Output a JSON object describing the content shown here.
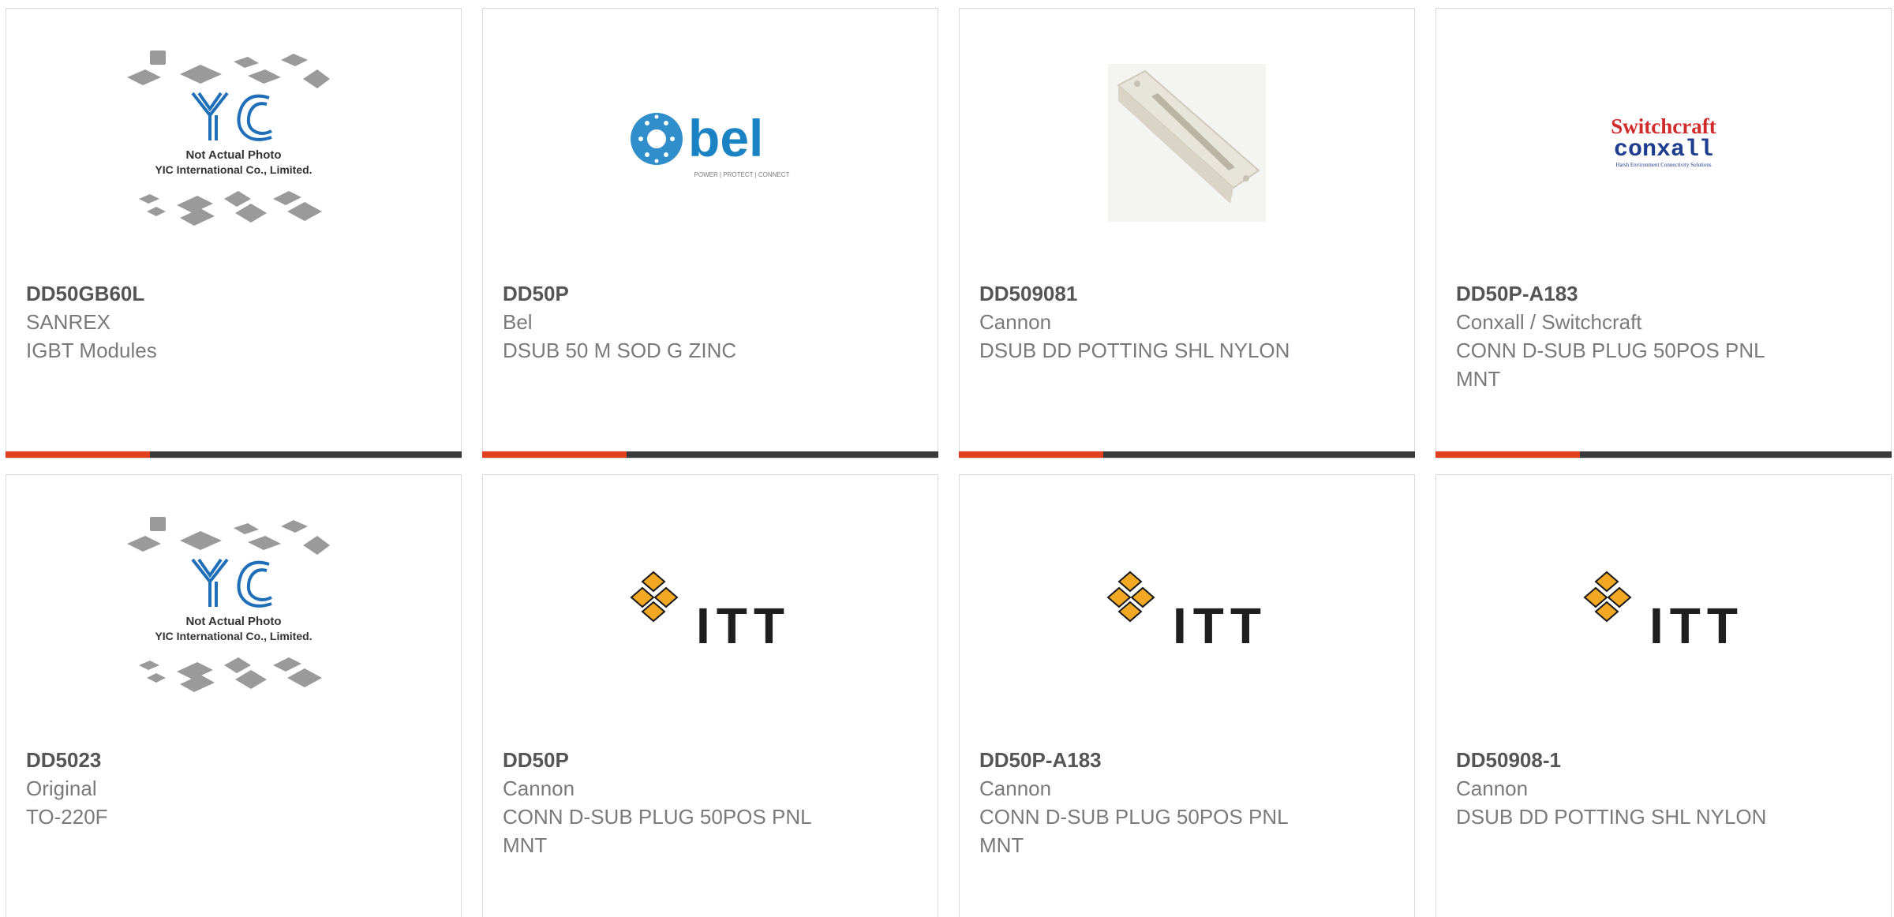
{
  "colors": {
    "accent": "#e0401f",
    "bar": "#3a3a3a",
    "bel_blue": "#1a83c4",
    "switchcraft_red": "#d12a2a",
    "conxall_blue": "#1f3d8f",
    "itt_gold": "#f3a823",
    "yic_blue": "#1f6fb8"
  },
  "products": [
    {
      "part": "DD50GB60L",
      "manufacturer": "SANREX",
      "description": "IGBT Modules",
      "image": "yic-placeholder",
      "image_text_1": "Not Actual Photo",
      "image_text_2": "YIC International Co., Limited.",
      "logo_text": "YIC"
    },
    {
      "part": "DD50P",
      "manufacturer": "Bel",
      "description": "DSUB 50 M SOD G ZINC",
      "image": "bel-logo",
      "logo_text": "bel",
      "tagline": "POWER | PROTECT | CONNECT"
    },
    {
      "part": "DD509081",
      "manufacturer": "Cannon",
      "description": "DSUB DD POTTING SHL NYLON",
      "image": "potting-shell-photo"
    },
    {
      "part": "DD50P-A183",
      "manufacturer": "Conxall / Switchcraft",
      "description": "CONN D-SUB PLUG 50POS PNL MNT",
      "image": "switchcraft-conxall-logo",
      "logo_line_1": "Switchcraft",
      "logo_line_2": "conxall",
      "logo_tagline": "Harsh Environment Connectivity Solutions"
    },
    {
      "part": "DD5023",
      "manufacturer": "Original",
      "description": "TO-220F",
      "image": "yic-placeholder",
      "image_text_1": "Not Actual Photo",
      "image_text_2": "YIC International Co., Limited.",
      "logo_text": "YIC"
    },
    {
      "part": "DD50P",
      "manufacturer": "Cannon",
      "description": "CONN D-SUB PLUG 50POS PNL MNT",
      "image": "itt-logo",
      "logo_text": "ITT"
    },
    {
      "part": "DD50P-A183",
      "manufacturer": "Cannon",
      "description": "CONN D-SUB PLUG 50POS PNL MNT",
      "image": "itt-logo",
      "logo_text": "ITT"
    },
    {
      "part": "DD50908-1",
      "manufacturer": "Cannon",
      "description": "DSUB DD POTTING SHL NYLON",
      "image": "itt-logo",
      "logo_text": "ITT"
    }
  ]
}
